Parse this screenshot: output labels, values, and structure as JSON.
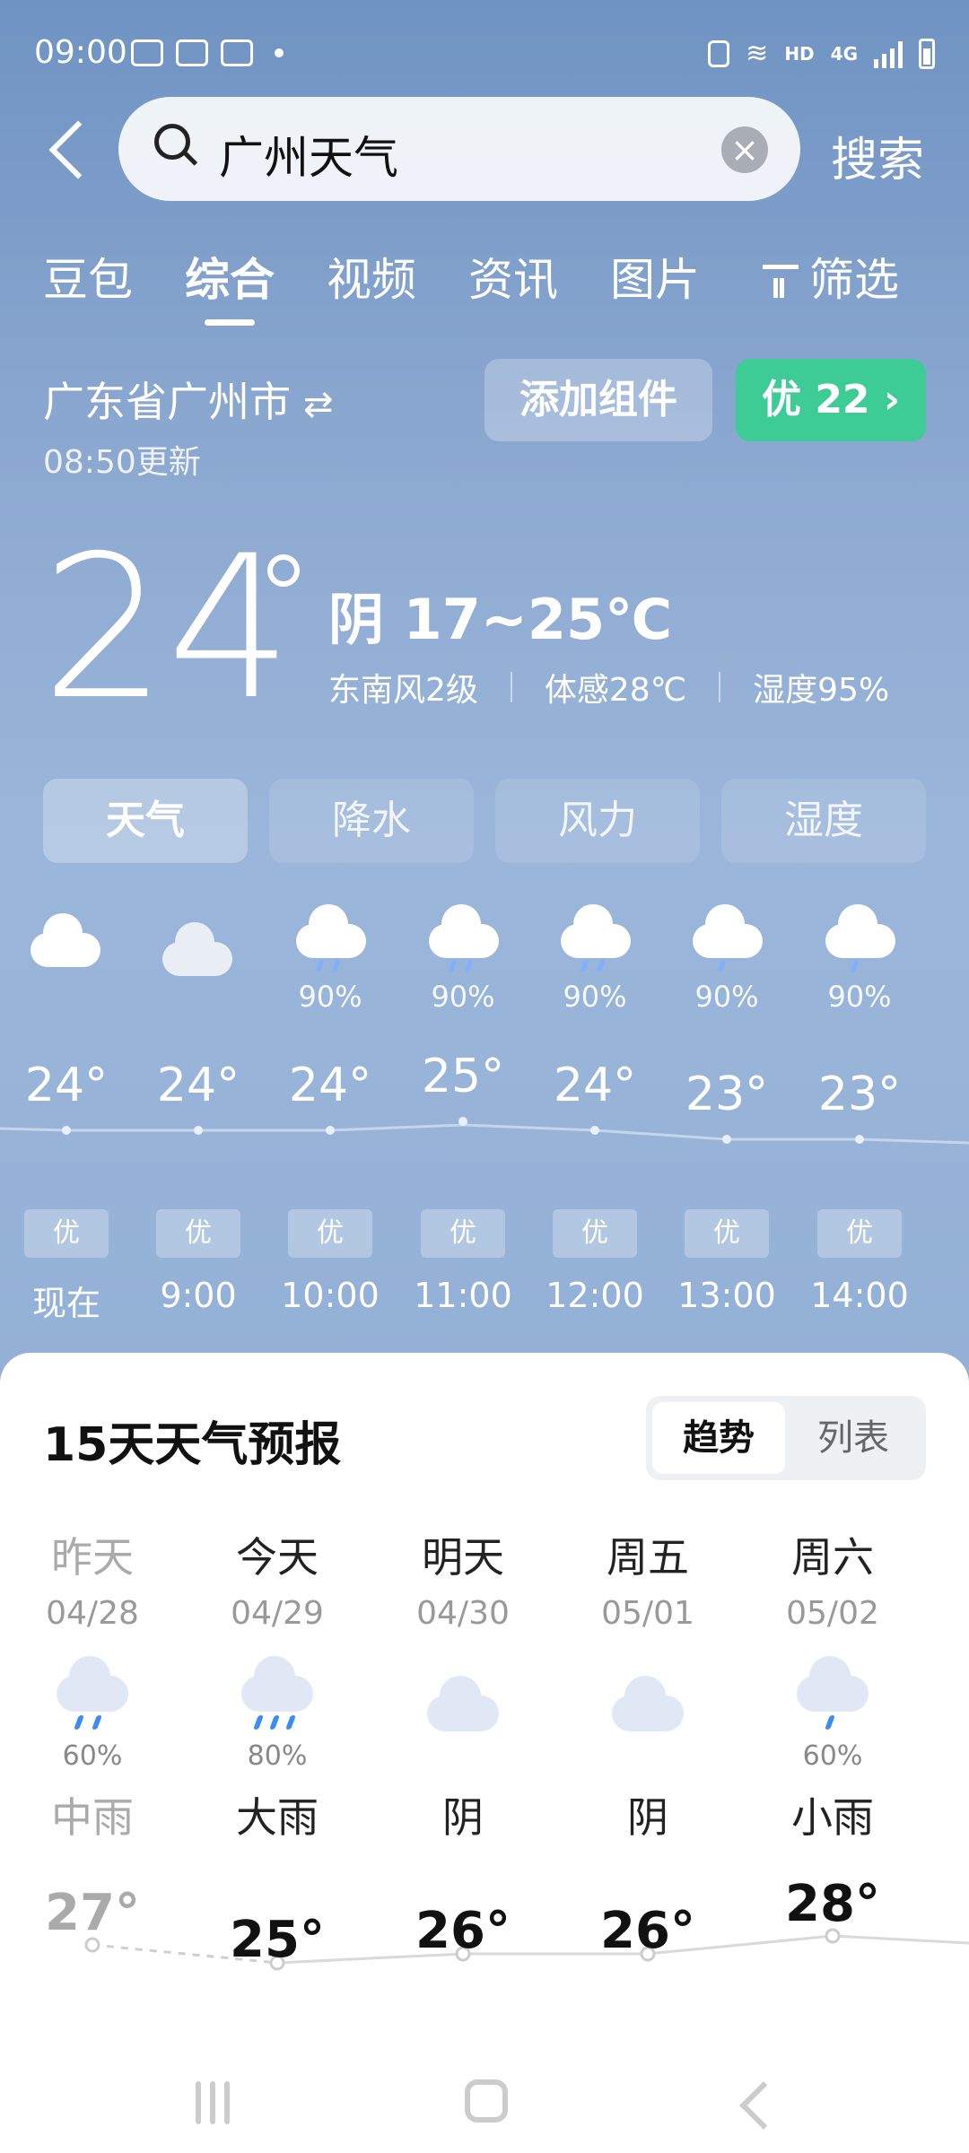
{
  "status_bar": {
    "time": "09:00",
    "hd": "HD",
    "net": "4G"
  },
  "search": {
    "query": "广州天气",
    "button": "搜索"
  },
  "tabs": [
    "豆包",
    "综合",
    "视频",
    "资讯",
    "图片",
    "筛选"
  ],
  "active_tab": "综合",
  "location": {
    "name": "广东省广州市",
    "swap_icon": "⇄",
    "updated": "08:50更新"
  },
  "actions": {
    "add_widget": "添加组件",
    "aqi": "优 22 ›"
  },
  "current": {
    "temp": "24",
    "condition": "阴  17~25℃",
    "wind": "东南风2级",
    "feels": "体感28℃",
    "humidity": "湿度95%"
  },
  "segments": [
    "天气",
    "降水",
    "风力",
    "湿度"
  ],
  "active_segment": "天气",
  "hourly": [
    {
      "time": "现在",
      "temp": "24°",
      "aqi": "优",
      "pct": "",
      "icon": "cloud-icon"
    },
    {
      "time": "9:00",
      "temp": "24°",
      "aqi": "优",
      "pct": "",
      "icon": "overcast-icon"
    },
    {
      "time": "10:00",
      "temp": "24°",
      "aqi": "优",
      "pct": "90%",
      "icon": "light-rain-icon"
    },
    {
      "time": "11:00",
      "temp": "25°",
      "aqi": "优",
      "pct": "90%",
      "icon": "light-rain-icon"
    },
    {
      "time": "12:00",
      "temp": "24°",
      "aqi": "优",
      "pct": "90%",
      "icon": "light-rain-icon"
    },
    {
      "time": "13:00",
      "temp": "23°",
      "aqi": "优",
      "pct": "90%",
      "icon": "light-rain-icon"
    },
    {
      "time": "14:00",
      "temp": "23°",
      "aqi": "优",
      "pct": "90%",
      "icon": "light-rain-icon"
    }
  ],
  "forecast": {
    "title": "15天天气预报",
    "toggle": [
      "趋势",
      "列表"
    ],
    "days": [
      {
        "name": "昨天",
        "date": "04/28",
        "pct": "60%",
        "desc": "中雨",
        "temp": "27°",
        "icon": "moderate-rain-icon"
      },
      {
        "name": "今天",
        "date": "04/29",
        "pct": "80%",
        "desc": "大雨",
        "temp": "25°",
        "icon": "heavy-rain-icon"
      },
      {
        "name": "明天",
        "date": "04/30",
        "pct": "",
        "desc": "阴",
        "temp": "26°",
        "icon": "overcast-icon"
      },
      {
        "name": "周五",
        "date": "05/01",
        "pct": "",
        "desc": "阴",
        "temp": "26°",
        "icon": "overcast-icon"
      },
      {
        "name": "周六",
        "date": "05/02",
        "pct": "60%",
        "desc": "小雨",
        "temp": "28°",
        "icon": "light-rain-icon"
      }
    ]
  },
  "colors": {
    "aqi_green": "#3dcc95",
    "sky": "#8aa7cf"
  }
}
